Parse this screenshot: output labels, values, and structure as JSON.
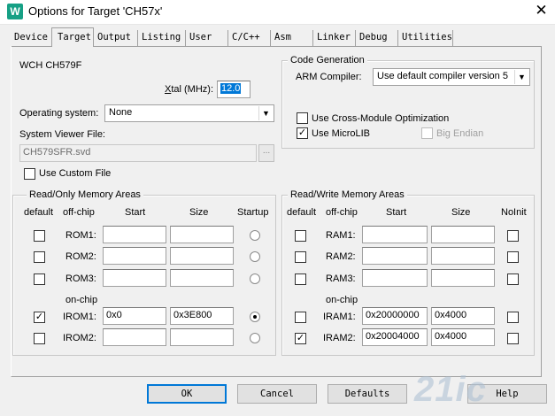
{
  "window": {
    "title": "Options for Target 'CH57x'"
  },
  "tabs": [
    "Device",
    "Target",
    "Output",
    "Listing",
    "User",
    "C/C++",
    "Asm",
    "Linker",
    "Debug",
    "Utilities"
  ],
  "active_tab": "Target",
  "device_name": "WCH CH579F",
  "xtal": {
    "label_prefix": "",
    "label_accel": "X",
    "label_rest": "tal (MHz):",
    "value": "12.0"
  },
  "operating_system": {
    "label": "Operating system:",
    "value": "None"
  },
  "svd": {
    "label": "System Viewer File:",
    "value": "CH579SFR.svd",
    "browse_label": "..."
  },
  "use_custom_file": {
    "label": "Use Custom File",
    "checked": false
  },
  "code_generation": {
    "title": "Code Generation",
    "compiler_label": "ARM Compiler:",
    "compiler_value": "Use default compiler version 5",
    "cross_module": {
      "label": "Use Cross-Module Optimization",
      "checked": false
    },
    "microlib": {
      "label": "Use MicroLIB",
      "checked": true
    },
    "big_endian": {
      "label": "Big Endian",
      "checked": false,
      "enabled": false
    }
  },
  "rom": {
    "title": "Read/Only Memory Areas",
    "headers": {
      "default": "default",
      "offchip": "off-chip",
      "start": "Start",
      "size": "Size",
      "startup": "Startup"
    },
    "onchip_label": "on-chip",
    "rows": [
      {
        "name": "ROM1:",
        "default": false,
        "start": "",
        "size": "",
        "startup": false
      },
      {
        "name": "ROM2:",
        "default": false,
        "start": "",
        "size": "",
        "startup": false
      },
      {
        "name": "ROM3:",
        "default": false,
        "start": "",
        "size": "",
        "startup": false
      },
      {
        "name": "IROM1:",
        "default": true,
        "start": "0x0",
        "size": "0x3E800",
        "startup": true
      },
      {
        "name": "IROM2:",
        "default": false,
        "start": "",
        "size": "",
        "startup": false
      }
    ]
  },
  "ram": {
    "title": "Read/Write Memory Areas",
    "headers": {
      "default": "default",
      "offchip": "off-chip",
      "start": "Start",
      "size": "Size",
      "noinit": "NoInit"
    },
    "onchip_label": "on-chip",
    "rows": [
      {
        "name": "RAM1:",
        "default": false,
        "start": "",
        "size": "",
        "noinit": false
      },
      {
        "name": "RAM2:",
        "default": false,
        "start": "",
        "size": "",
        "noinit": false
      },
      {
        "name": "RAM3:",
        "default": false,
        "start": "",
        "size": "",
        "noinit": false
      },
      {
        "name": "IRAM1:",
        "default": false,
        "start": "0x20000000",
        "size": "0x4000",
        "noinit": false
      },
      {
        "name": "IRAM2:",
        "default": true,
        "start": "0x20004000",
        "size": "0x4000",
        "noinit": false
      }
    ]
  },
  "buttons": {
    "ok": "OK",
    "cancel": "Cancel",
    "defaults": "Defaults",
    "help": "Help"
  },
  "watermark": "21ic"
}
